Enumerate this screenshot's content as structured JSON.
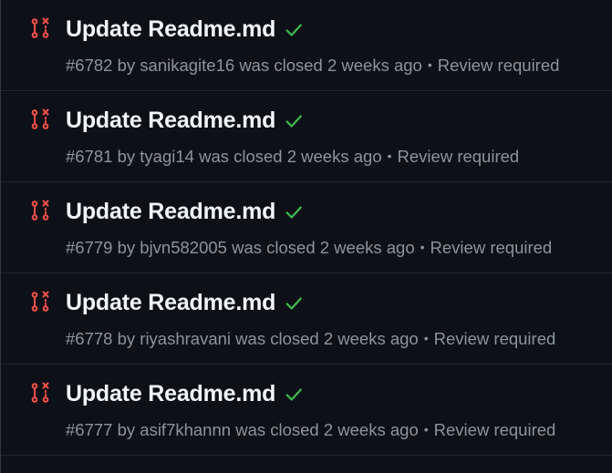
{
  "colors": {
    "background": "#0d1117",
    "closed_icon": "#f85149",
    "check": "#3fb950",
    "title": "#f0f6fc",
    "meta": "#8b949e"
  },
  "pull_requests": [
    {
      "title": "Update Readme.md",
      "number": "#6782",
      "by_text": "by",
      "author": "sanikagite16",
      "status": "was closed 2 weeks ago",
      "separator": "•",
      "review": "Review required",
      "status_icon": "git-pull-request-closed-icon",
      "check_icon": "check-icon"
    },
    {
      "title": "Update Readme.md",
      "number": "#6781",
      "by_text": "by",
      "author": "tyagi14",
      "status": "was closed 2 weeks ago",
      "separator": "•",
      "review": "Review required",
      "status_icon": "git-pull-request-closed-icon",
      "check_icon": "check-icon"
    },
    {
      "title": "Update Readme.md",
      "number": "#6779",
      "by_text": "by",
      "author": "bjvn582005",
      "status": "was closed 2 weeks ago",
      "separator": "•",
      "review": "Review required",
      "status_icon": "git-pull-request-closed-icon",
      "check_icon": "check-icon"
    },
    {
      "title": "Update Readme.md",
      "number": "#6778",
      "by_text": "by",
      "author": "riyashravani",
      "status": "was closed 2 weeks ago",
      "separator": "•",
      "review": "Review required",
      "status_icon": "git-pull-request-closed-icon",
      "check_icon": "check-icon"
    },
    {
      "title": "Update Readme.md",
      "number": "#6777",
      "by_text": "by",
      "author": "asif7khannn",
      "status": "was closed 2 weeks ago",
      "separator": "•",
      "review": "Review required",
      "status_icon": "git-pull-request-closed-icon",
      "check_icon": "check-icon"
    }
  ]
}
